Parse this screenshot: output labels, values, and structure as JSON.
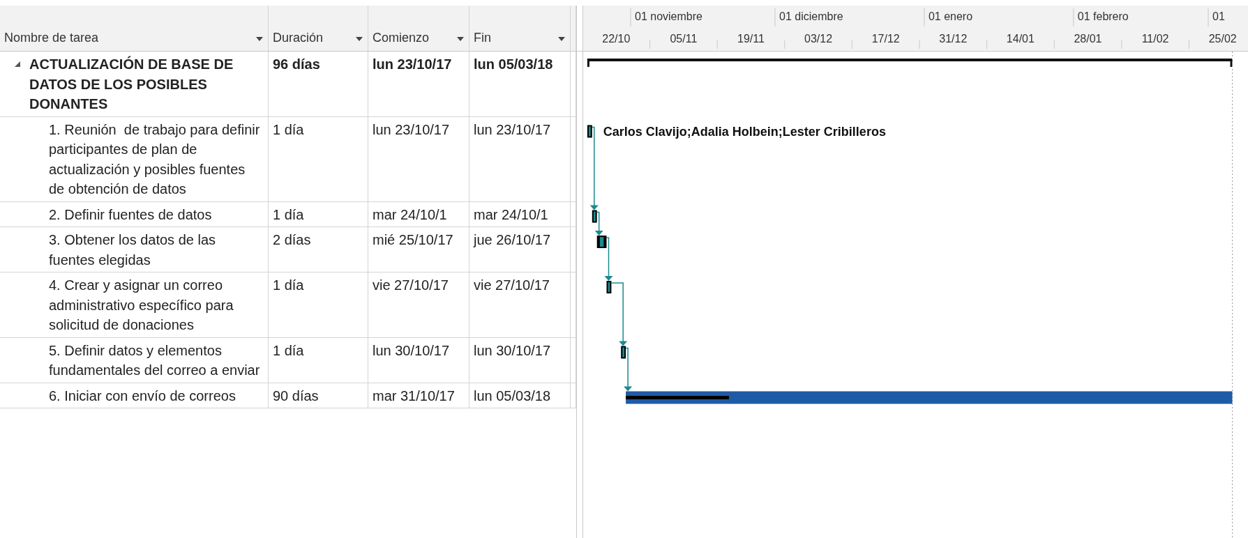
{
  "columns": [
    {
      "label": "Nombre de tarea"
    },
    {
      "label": "Duración"
    },
    {
      "label": "Comienzo"
    },
    {
      "label": "Fin"
    }
  ],
  "timescale": {
    "months": [
      "01 noviembre",
      "01 diciembre",
      "01 enero",
      "01 febrero",
      "01"
    ],
    "weeks": [
      "22/10",
      "05/11",
      "19/11",
      "03/12",
      "17/12",
      "31/12",
      "14/01",
      "28/01",
      "11/02",
      "25/02"
    ]
  },
  "tasks": [
    {
      "kind": "summary",
      "expanded": true,
      "name": "ACTUALIZACIÓN DE BASE DE DATOS DE LOS POSIBLES DONANTES",
      "duration": "96 días",
      "start": "lun 23/10/17",
      "finish": "lun 05/03/18"
    },
    {
      "kind": "task",
      "name": "1. Reunión  de trabajo para definir participantes de plan de actualización y posibles fuentes de obtención de datos",
      "duration": "1 día",
      "start": "lun 23/10/17",
      "finish": "lun 23/10/17",
      "resources": "Carlos Clavijo;Adalia Holbein;Lester Cribilleros"
    },
    {
      "kind": "task",
      "name": "2. Definir fuentes de datos",
      "duration": "1 día",
      "start": "mar 24/10/1",
      "finish": "mar 24/10/1"
    },
    {
      "kind": "task",
      "name": "3. Obtener los datos de las fuentes elegidas",
      "duration": "2 días",
      "start": "mié 25/10/17",
      "finish": "jue 26/10/17"
    },
    {
      "kind": "task",
      "name": "4. Crear y asignar un correo administrativo específico para solicitud de donaciones",
      "duration": "1 día",
      "start": "vie 27/10/17",
      "finish": "vie 27/10/17"
    },
    {
      "kind": "task",
      "name": "5. Definir datos y elementos fundamentales del correo a enviar",
      "duration": "1 día",
      "start": "lun 30/10/17",
      "finish": "lun 30/10/17"
    },
    {
      "kind": "task",
      "name": "6. Iniciar con envío de correos",
      "duration": "90 días",
      "start": "mar 31/10/17",
      "finish": "lun 05/03/18",
      "level": 0.17
    }
  ]
}
